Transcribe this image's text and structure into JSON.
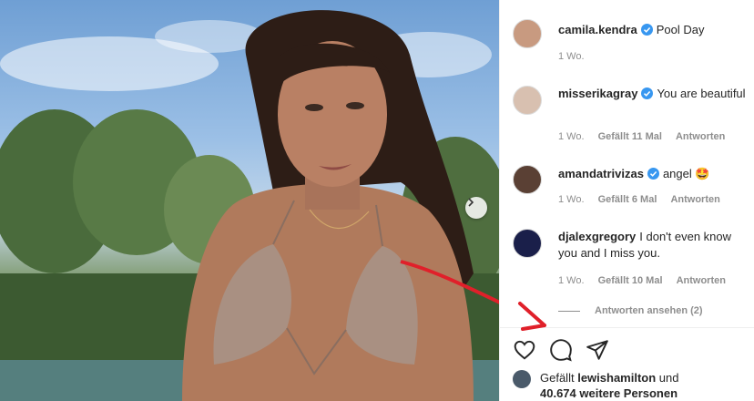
{
  "post": {
    "author": "camila.kendra",
    "caption": "Pool Day",
    "time": "1 Wo."
  },
  "comments": [
    {
      "user": "misserikagray",
      "verified": true,
      "text": "You are beautiful",
      "time": "1 Wo.",
      "likes": "Gefällt 11 Mal",
      "reply": "Antworten"
    },
    {
      "user": "amandatrivizas",
      "verified": true,
      "text": "angel 🤩",
      "time": "1 Wo.",
      "likes": "Gefällt 6 Mal",
      "reply": "Antworten"
    },
    {
      "user": "djalexgregory",
      "verified": false,
      "text": "I don't even know you and I miss you.",
      "time": "1 Wo.",
      "likes": "Gefällt 10 Mal",
      "reply": "Antworten"
    }
  ],
  "view_replies": "Antworten ansehen (2)",
  "liked_by": {
    "prefix": "Gefällt",
    "user": "lewishamilton",
    "conj": "und",
    "others": "40.674 weitere Personen"
  },
  "colors": {
    "verified": "#3897f0",
    "annotation_arrow": "#e0202a"
  },
  "icons": [
    "heart-icon",
    "comment-icon",
    "share-icon",
    "chevron-right-icon",
    "verified-badge-icon"
  ]
}
